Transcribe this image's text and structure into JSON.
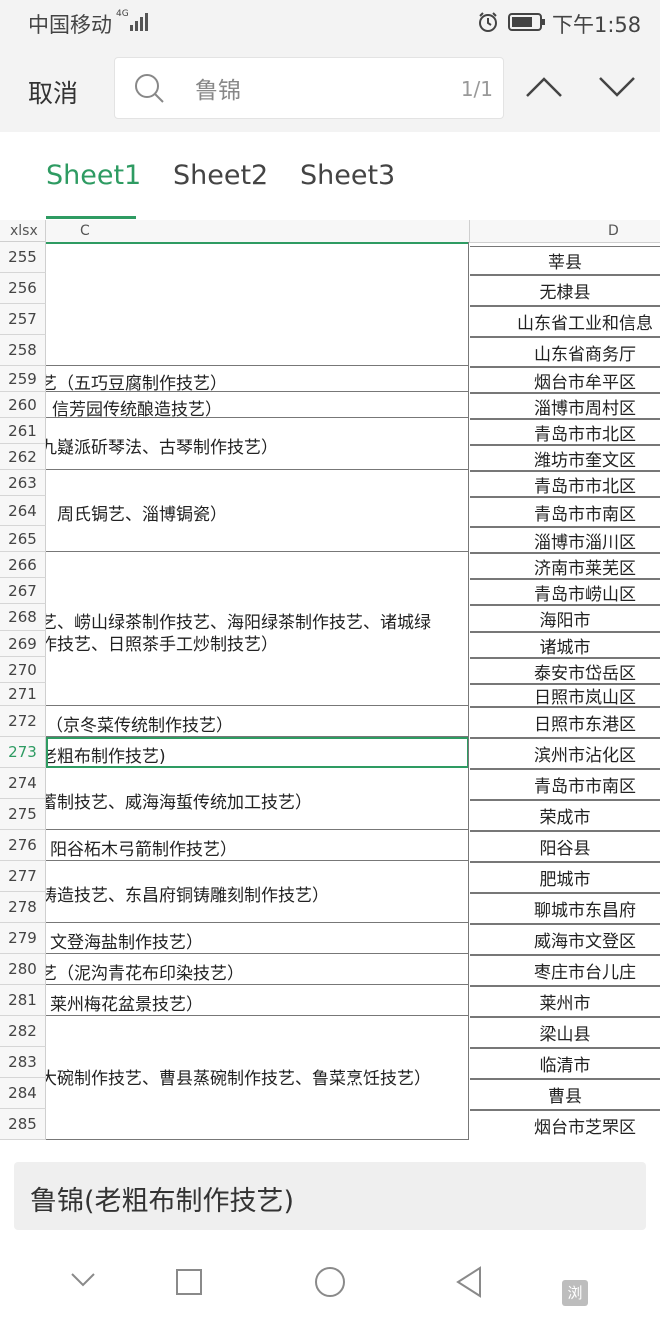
{
  "status_bar": {
    "carrier": "中国移动",
    "network": "4G",
    "time": "下午1:58"
  },
  "search": {
    "cancel_label": "取消",
    "query": "鲁锦",
    "match_count": "1/1"
  },
  "sheet_tabs": {
    "tabs": [
      "Sheet1",
      "Sheet2",
      "Sheet3"
    ],
    "active": "Sheet1"
  },
  "grid": {
    "corner_label": "xlsx",
    "column_c_header": "C",
    "column_d_header": "D",
    "selected_row": "273",
    "rows": [
      "255",
      "256",
      "257",
      "258",
      "259",
      "260",
      "261",
      "262",
      "263",
      "264",
      "265",
      "266",
      "267",
      "268",
      "269",
      "270",
      "271",
      "272",
      "273",
      "274",
      "275",
      "276",
      "277",
      "278",
      "279",
      "280",
      "281",
      "282",
      "283",
      "284",
      "285"
    ],
    "column_c": {
      "r259": "艺（五巧豆腐制作技艺）",
      "r260": "信芳园传统酿造技艺）",
      "r261_262": "九嶷派斫琴法、古琴制作技艺）",
      "r263_265": "、周氏锔艺、淄博锔瓷）",
      "r266_271_line1": "艺、崂山绿茶制作技艺、海阳绿茶制作技艺、诸城绿",
      "r266_271_line2": "作技艺、日照茶手工炒制技艺）",
      "r272": "（京冬菜传统制作技艺）",
      "r273": "老粗布制作技艺)",
      "r274_275": "蓄制技艺、威海海蜇传统加工技艺）",
      "r276": "阳谷柘木弓箭制作技艺）",
      "r277_278": "铸造技艺、东昌府铜铸雕刻制作技艺）",
      "r279": "文登海盐制作技艺）",
      "r280": "艺（泥沟青花布印染技艺）",
      "r281": "莱州梅花盆景技艺）",
      "r282_285": "大碗制作技艺、曹县蒸碗制作技艺、鲁菜烹饪技艺）"
    },
    "column_d": [
      "莘县",
      "无棣县",
      "山东省工业和信息",
      "山东省商务厅",
      "烟台市牟平区",
      "淄博市周村区",
      "青岛市市北区",
      "潍坊市奎文区",
      "青岛市市北区",
      "青岛市市南区",
      "淄博市淄川区",
      "济南市莱芜区",
      "青岛市崂山区",
      "海阳市",
      "诸城市",
      "泰安市岱岳区",
      "日照市岚山区",
      "日照市东港区",
      "滨州市沾化区",
      "青岛市市南区",
      "荣成市",
      "阳谷县",
      "肥城市",
      "聊城市东昌府",
      "威海市文登区",
      "枣庄市台儿庄",
      "莱州市",
      "梁山县",
      "临清市",
      "曹县",
      "烟台市芝罘区"
    ]
  },
  "cell_content": "鲁锦(老粗布制作技艺)",
  "watermark": "浏",
  "colors": {
    "accent": "#2e9b62",
    "chrome_bg": "#f3f3f3"
  }
}
